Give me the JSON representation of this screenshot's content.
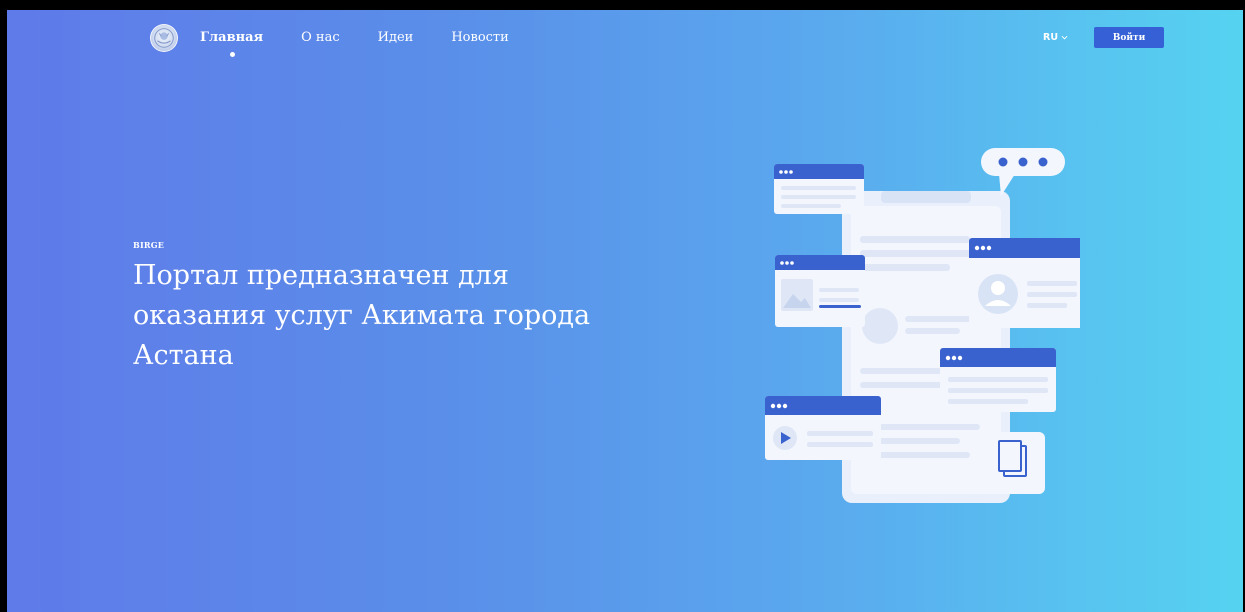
{
  "header": {
    "logo": "city-emblem",
    "nav": [
      {
        "label": "Главная",
        "active": true
      },
      {
        "label": "О нас",
        "active": false
      },
      {
        "label": "Идеи",
        "active": false
      },
      {
        "label": "Новости",
        "active": false
      }
    ],
    "language": {
      "value": "RU",
      "icon": "chevron-down-icon"
    },
    "login_label": "Войти"
  },
  "hero": {
    "eyebrow": "BIRGE",
    "title": "Портал предназначен для оказания услуг Акимата города Астана"
  },
  "colors": {
    "gradient_start": "#5f7ae9",
    "gradient_end": "#56d3f1",
    "accent": "#3560d6",
    "card_header": "#3a62cf",
    "card_bg": "#f3f6fc"
  }
}
